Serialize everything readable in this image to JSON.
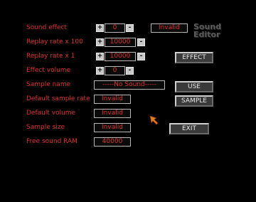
{
  "title": {
    "line1": "Sound",
    "line2": "Editor"
  },
  "rows": [
    {
      "label": "Sound effect",
      "value": "0"
    },
    {
      "label": "Replay rate x 100",
      "value": "10000"
    },
    {
      "label": "Replay rate x 1",
      "value": "10000"
    },
    {
      "label": "Effect volume",
      "value": "0"
    },
    {
      "label": "Sample name",
      "value": "-----No Sound-----"
    },
    {
      "label": "Default sample rate",
      "value": "Invalid"
    },
    {
      "label": "Default  volume",
      "value": "Invalid"
    },
    {
      "label": "Sample size",
      "value": "Invalid"
    },
    {
      "label": "Free sound RAM",
      "value": "40000"
    }
  ],
  "status": "Invalid",
  "stepper": {
    "plus": "+",
    "minus": "-"
  },
  "buttons": {
    "effect": "EFFECT",
    "use": "USE",
    "sample": "SAMPLE",
    "exit": "EXIT"
  },
  "cursor_icon": "arrow-cursor-icon"
}
